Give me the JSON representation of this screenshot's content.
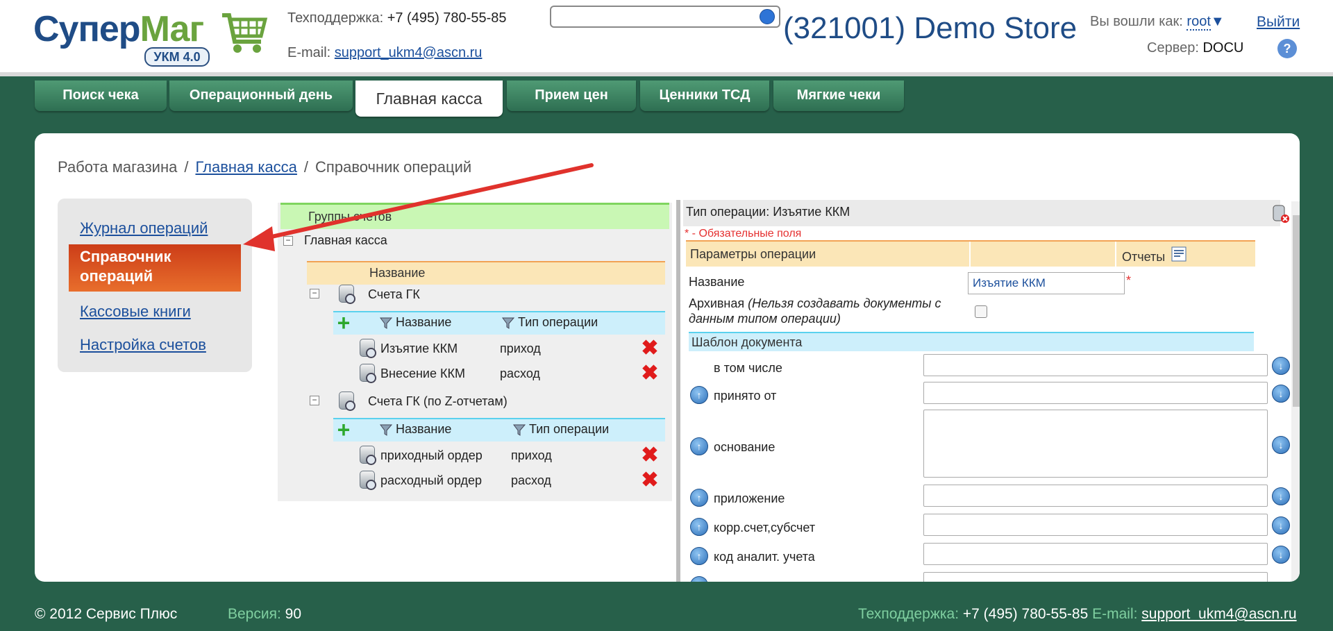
{
  "header": {
    "logo_a": "Супер",
    "logo_b": "Маг",
    "logo_badge": "УКМ 4.0",
    "support_label": "Техподдержка:",
    "support_phone": "+7 (495) 780-55-85",
    "email_label": "E-mail:",
    "email": "support_ukm4@ascn.ru",
    "search_placeholder": "",
    "store_title": "(321001) Demo Store",
    "logged_label": "Вы вошли как:",
    "user": "root",
    "logout": "Выйти",
    "server_label": "Сервер:",
    "server": "DOCU",
    "help": "?"
  },
  "tabs": [
    "Поиск чека",
    "Операционный день",
    "Главная касса",
    "Прием цен",
    "Ценники ТСД",
    "Мягкие чеки"
  ],
  "breadcrumb": {
    "root": "Работа магазина",
    "link": "Главная касса",
    "current": "Справочник операций"
  },
  "sidemenu": {
    "journal": "Журнал операций",
    "active": "Справочник операций",
    "cashbooks": "Кассовые книги",
    "accounts": "Настройка счетов"
  },
  "tree": {
    "groups_header": "Группы счетов",
    "root": "Главная касса",
    "name_header": "Название",
    "group1": "Счета ГК",
    "group2": "Счета ГК (по Z-отчетам)",
    "col_name": "Название",
    "col_type": "Тип операции",
    "g1_rows": [
      {
        "name": "Изъятие ККМ",
        "type": "приход"
      },
      {
        "name": "Внесение ККМ",
        "type": "расход"
      }
    ],
    "g2_rows": [
      {
        "name": "приходный ордер",
        "type": "приход"
      },
      {
        "name": "расходный ордер",
        "type": "расход"
      }
    ]
  },
  "form": {
    "title": "Тип операции: Изъятие ККМ",
    "required_note": "* - Обязательные поля",
    "params_header": "Параметры операции",
    "reports": "Отчеты",
    "name_label": "Название",
    "name_value": "Изъятие ККМ",
    "archive_label": "Архивная",
    "archive_note": "(Нельзя создавать документы с данным типом операции)",
    "template_header": "Шаблон документа",
    "fields": [
      "в том числе",
      "принято от",
      "основание",
      "приложение",
      "корр.счет,субсчет",
      "код аналит. учета"
    ]
  },
  "footer": {
    "copyright": "© 2012 Сервис Плюс",
    "version_label": "Версия:",
    "version": "90",
    "support_label": "Техподдержка:",
    "support_phone": "+7 (495) 780-55-85",
    "email_label": "E-mail:",
    "email": "support_ukm4@ascn.ru"
  },
  "colors": {
    "background": "#27604a",
    "active_menu": "#d24a1e",
    "annotation_arrow": "#e0322c"
  }
}
